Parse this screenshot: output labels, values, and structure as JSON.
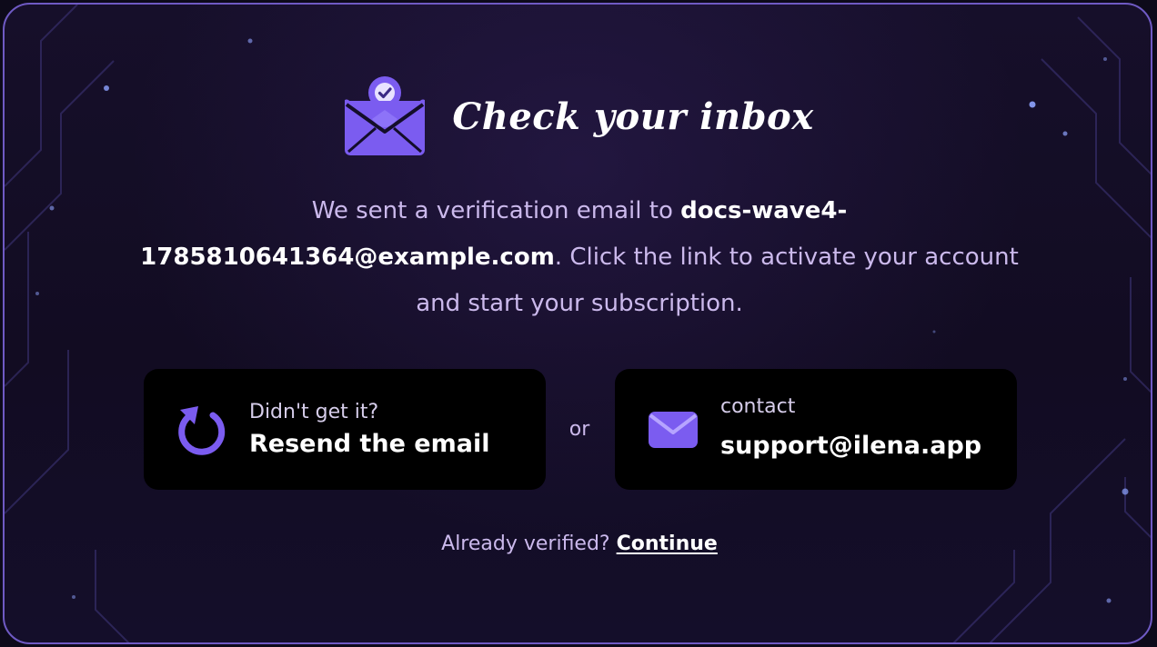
{
  "heading": {
    "title": "Check your inbox",
    "icon": "mail-check-icon"
  },
  "message": {
    "prefix": "We sent a verification email to ",
    "email": "docs-wave4-1785810641364@example.com",
    "suffix": ". Click the link to activate your account and start your subscription."
  },
  "resend": {
    "icon": "refresh-icon",
    "small_label": "Didn't get it?",
    "big_label": "Resend the email"
  },
  "separator": "or",
  "contact": {
    "icon": "mail-icon",
    "small_label": "contact",
    "big_label": "support@ilena.app"
  },
  "footer": {
    "prompt": "Already verified?",
    "link_label": "Continue"
  },
  "colors": {
    "accent": "#7b5cf0",
    "border": "#6f5ac4",
    "muted_text": "#cbb9ec",
    "background": "#120c22",
    "button_bg": "#000000"
  }
}
